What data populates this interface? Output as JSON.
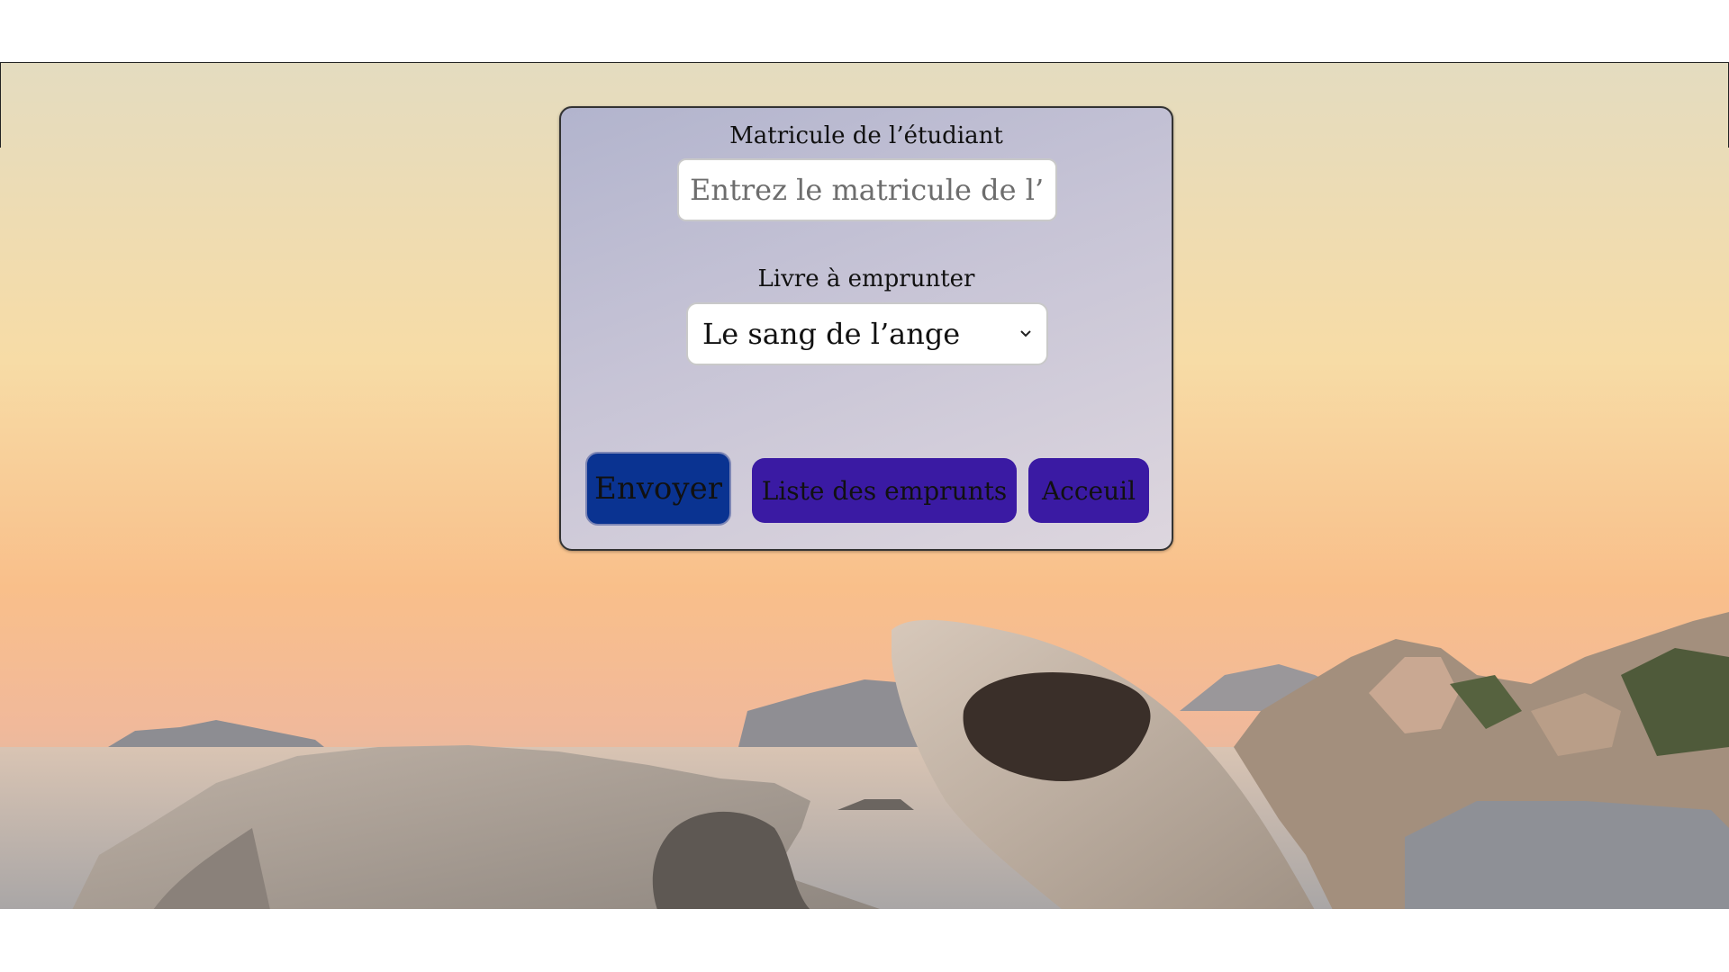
{
  "form": {
    "matricule_label": "Matricule de l’étudiant",
    "matricule_placeholder": "Entrez le matricule de l’é",
    "livre_label": "Livre à emprunter",
    "livre_selected": "Le sang de l’ange"
  },
  "buttons": {
    "envoyer": "Envoyer",
    "liste": "Liste des emprunts",
    "accueil": "Acceuil"
  },
  "colors": {
    "envoyer_bg": "#0a3391",
    "secondary_bg": "#3a1aa3",
    "card_bg": "#c7c4d6"
  },
  "icons": {
    "select_arrow": "chevron-down-icon"
  }
}
